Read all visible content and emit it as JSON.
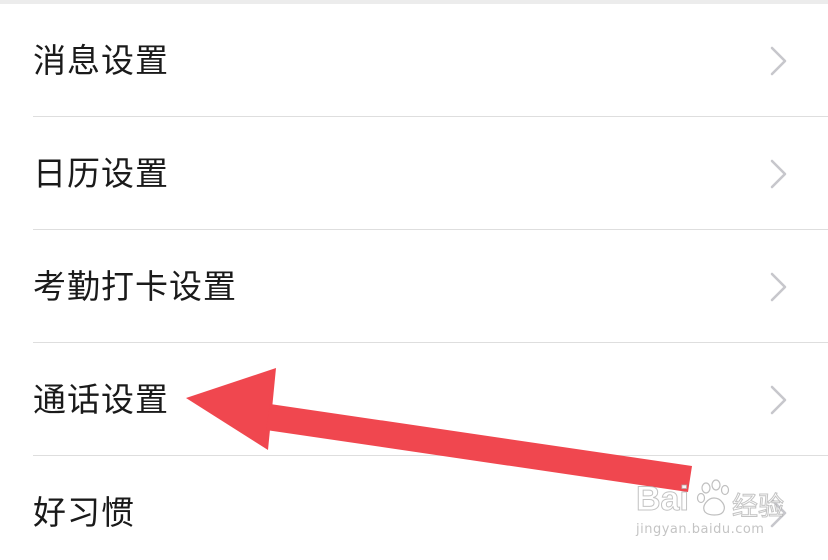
{
  "settings": {
    "items": [
      {
        "label": "消息设置"
      },
      {
        "label": "日历设置"
      },
      {
        "label": "考勤打卡设置"
      },
      {
        "label": "通话设置"
      },
      {
        "label": "好习惯"
      }
    ],
    "chevron_icon": "chevron-right-icon"
  },
  "annotation": {
    "arrow_icon": "arrow-left-icon",
    "arrow_color": "#f0474f"
  },
  "watermark": {
    "brand_prefix": "Bai",
    "brand_suffix": "",
    "brand_cn": "经验",
    "url": "jingyan.baidu.com"
  },
  "colors": {
    "text": "#1a1a1a",
    "divider": "#dedede",
    "chevron": "#c7c7cc"
  }
}
